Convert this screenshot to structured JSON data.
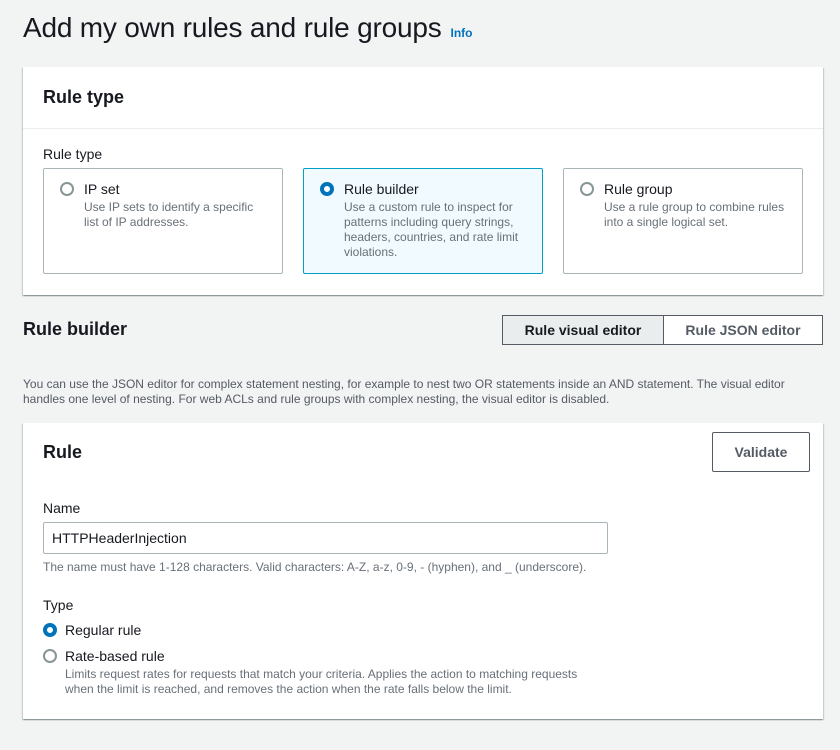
{
  "page": {
    "title": "Add my own rules and rule groups",
    "info_link": "Info"
  },
  "rule_type_panel": {
    "header": "Rule type",
    "field_label": "Rule type",
    "options": [
      {
        "title": "IP set",
        "description": "Use IP sets to identify a specific list of IP addresses.",
        "selected": false
      },
      {
        "title": "Rule builder",
        "description": "Use a custom rule to inspect for patterns including query strings, headers, countries, and rate limit violations.",
        "selected": true
      },
      {
        "title": "Rule group",
        "description": "Use a rule group to combine rules into a single logical set.",
        "selected": false
      }
    ]
  },
  "rule_builder": {
    "title": "Rule builder",
    "visual_editor_label": "Rule visual editor",
    "json_editor_label": "Rule JSON editor",
    "active_editor": "Rule visual editor",
    "note": "You can use the JSON editor for complex statement nesting, for example to nest two OR statements inside an AND statement. The visual editor handles one level of nesting. For web ACLs and rule groups with complex nesting, the visual editor is disabled."
  },
  "rule_panel": {
    "header": "Rule",
    "validate_label": "Validate",
    "name_label": "Name",
    "name_value": "HTTPHeaderInjection",
    "name_hint": "The name must have 1-128 characters. Valid characters: A-Z, a-z, 0-9, - (hyphen), and _ (underscore).",
    "type_label": "Type",
    "type_options": [
      {
        "label": "Regular rule",
        "description": "",
        "selected": true
      },
      {
        "label": "Rate-based rule",
        "description": "Limits request rates for requests that match your criteria. Applies the action to matching requests when the limit is reached, and removes the action when the rate falls below the limit.",
        "selected": false
      }
    ]
  },
  "colors": {
    "accent": "#0073bb",
    "selected_tile_bg": "#f1faff",
    "selected_tile_border": "#00a1c9",
    "page_bg": "#f2f3f3"
  },
  "icons": [
    "radio-unselected-icon",
    "radio-selected-icon"
  ]
}
